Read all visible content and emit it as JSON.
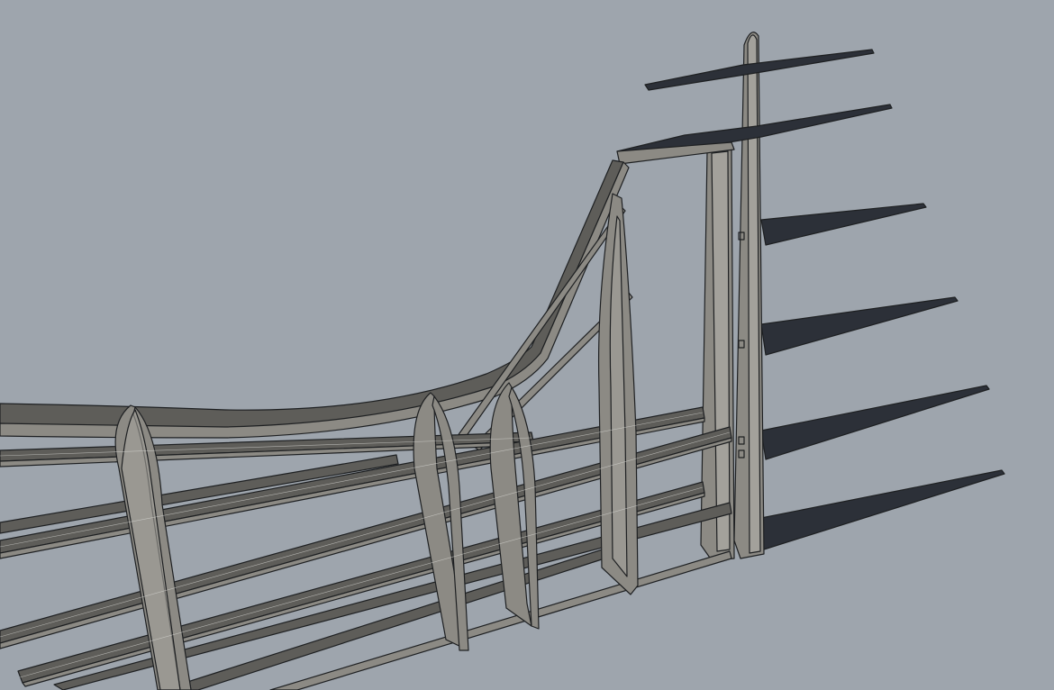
{
  "viewport": {
    "background": "#9ea5ad",
    "model_face_color": "#8c8a84",
    "model_shadow_color": "#2c3038",
    "edge_color": "#1e2022"
  }
}
